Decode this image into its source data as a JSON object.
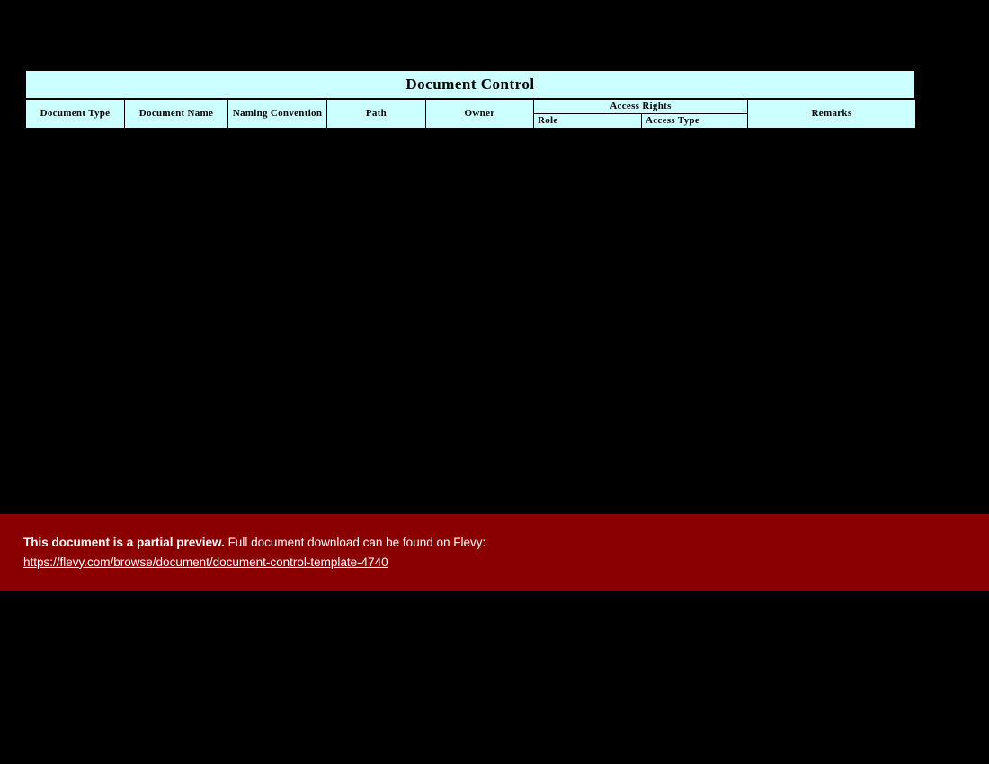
{
  "table": {
    "title": "Document Control",
    "columns": {
      "doc_type": "Document Type",
      "doc_name": "Document Name",
      "naming_convention": "Naming Convention",
      "path": "Path",
      "owner": "Owner",
      "access_rights": "Access Rights",
      "remarks": "Remarks"
    },
    "sub_columns": {
      "role": "Role",
      "access_type": "Access Type"
    }
  },
  "banner": {
    "bold_text": "This document is a partial preview.",
    "rest_text": "  Full document download can be found on Flevy:",
    "link_text": "https://flevy.com/browse/document/document-control-template-4740"
  }
}
